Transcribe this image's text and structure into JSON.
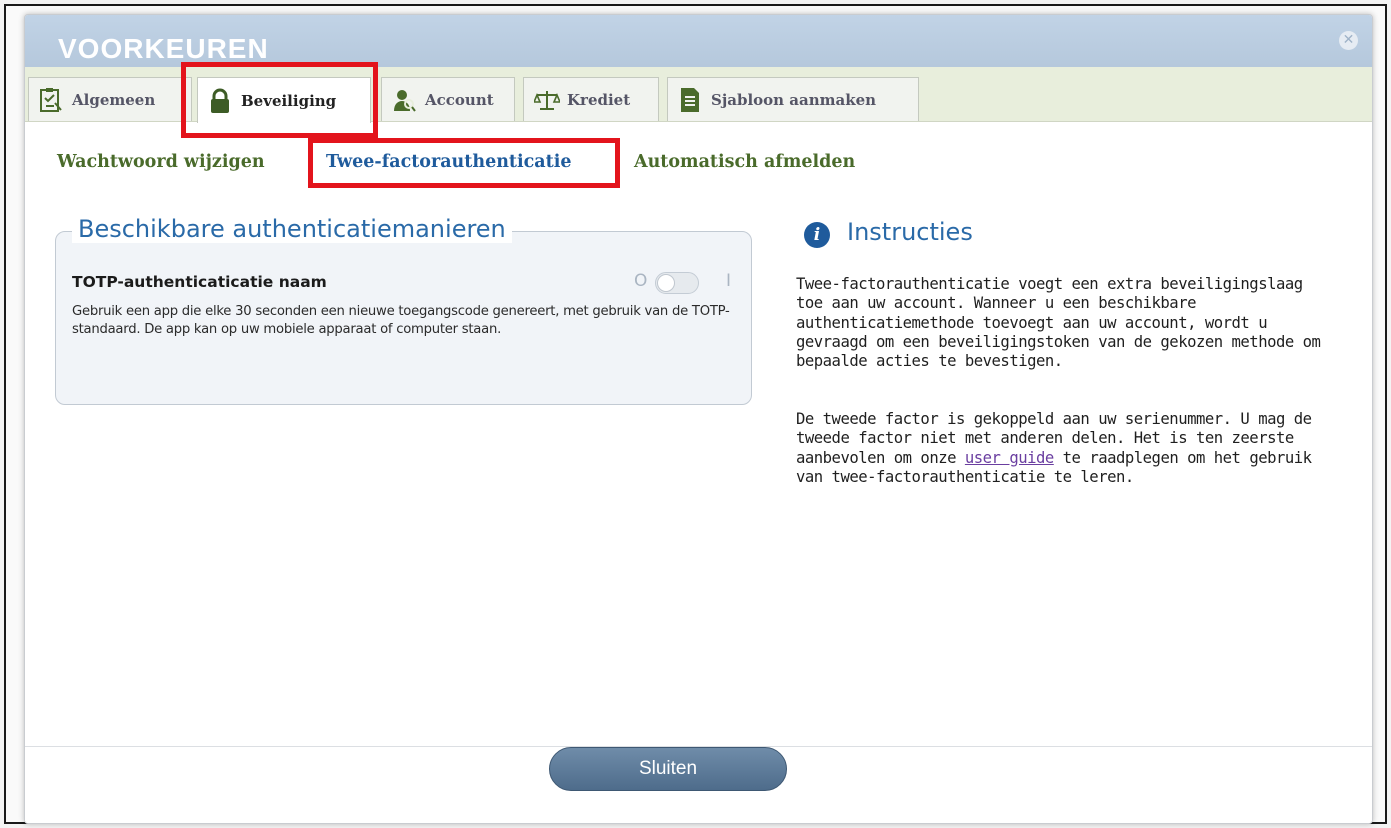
{
  "window": {
    "title": "VOORKEUREN",
    "close_symbol": "✕"
  },
  "tabs": [
    {
      "label": "Algemeen",
      "icon": "checklist-icon",
      "active": false
    },
    {
      "label": "Beveiliging",
      "icon": "lock-icon",
      "active": true
    },
    {
      "label": "Account",
      "icon": "person-search-icon",
      "active": false
    },
    {
      "label": "Krediet",
      "icon": "scales-icon",
      "active": false
    },
    {
      "label": "Sjabloon aanmaken",
      "icon": "document-icon",
      "active": false
    }
  ],
  "subnav": [
    {
      "label": "Wachtwoord wijzigen",
      "active": false
    },
    {
      "label": "Twee-factorauthenticatie",
      "active": true
    },
    {
      "label": "Automatisch afmelden",
      "active": false
    }
  ],
  "methods": {
    "legend": "Beschikbare authenticatiemanieren",
    "item": {
      "title": "TOTP-authenticaticatie naam",
      "description": "Gebruik een app die elke 30 seconden een nieuwe toegangscode genereert, met gebruik van de TOTP-standaard. De app kan op uw mobiele apparaat of computer staan.",
      "toggle_off_label": "O",
      "toggle_on_label": "I",
      "enabled": false
    }
  },
  "instructions": {
    "icon": "info-icon",
    "title": "Instructies",
    "p1": "Twee-factorauthenticatie voegt een extra beveiligingslaag toe aan uw account. Wanneer u een beschikbare authenticatiemethode toevoegt aan uw account, wordt u gevraagd om een beveiligingstoken van de gekozen methode om bepaalde acties te bevestigen.",
    "p2_before": "De tweede factor is gekoppeld aan uw serienummer. U mag de tweede factor niet met anderen delen. Het is ten zeerste aanbevolen om onze ",
    "p2_link": "user guide",
    "p2_after": " te raadplegen om het gebruik van twee-factorauthenticatie te leren."
  },
  "footer": {
    "close_label": "Sluiten"
  },
  "colors": {
    "highlight": "#e3141c",
    "title_bar": "#b9cbe0",
    "tab_bar": "#e8eedc",
    "subnav_text": "#4a6b2b",
    "active_subnav": "#1f5b9c",
    "heading_blue": "#2a6aa8",
    "button": "#5e7c9b"
  }
}
